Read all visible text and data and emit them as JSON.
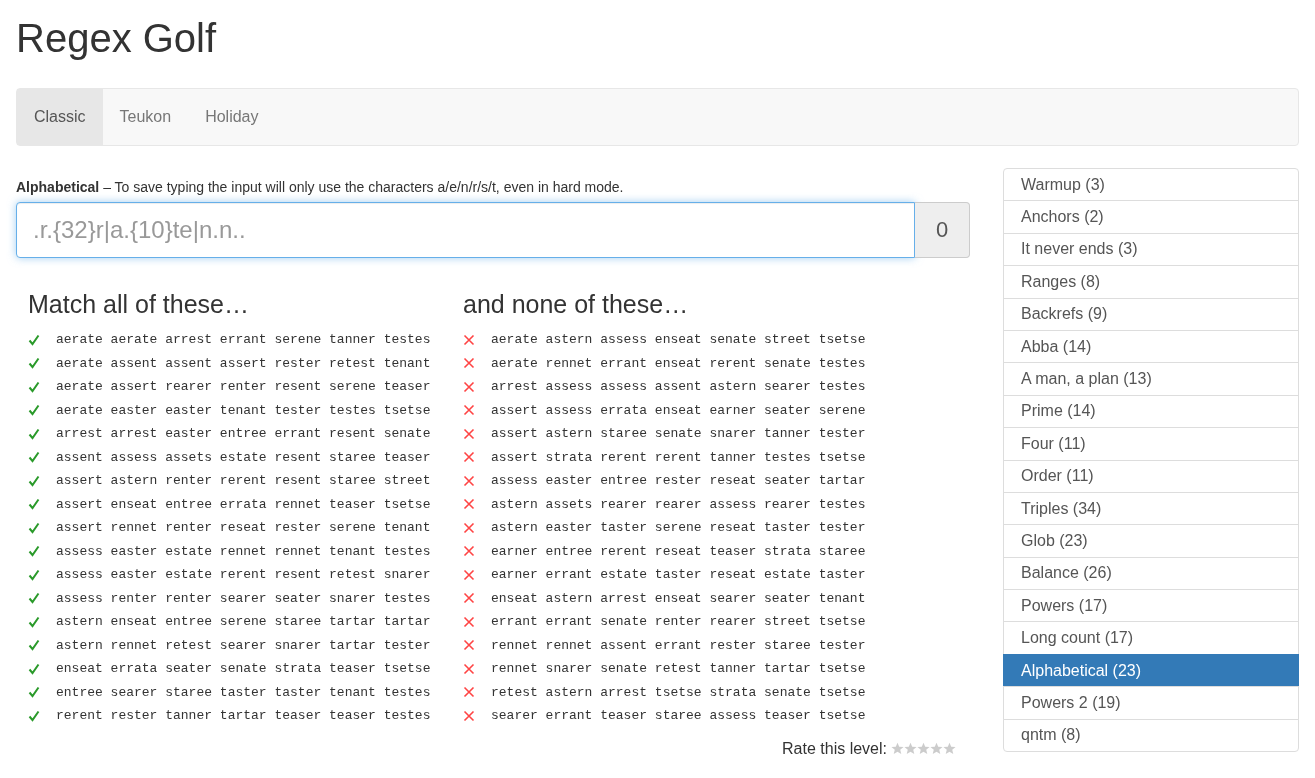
{
  "title": "Regex Golf",
  "tabs": [
    {
      "label": "Classic",
      "selected": true
    },
    {
      "label": "Teukon",
      "selected": false
    },
    {
      "label": "Holiday",
      "selected": false
    }
  ],
  "level": {
    "name": "Alphabetical",
    "description": " – To save typing the input will only use the characters a/e/n/r/s/t, even in hard mode."
  },
  "regex_input": {
    "placeholder": ".r.{32}r|a.{10}te|n.n..",
    "score": "0"
  },
  "columns": [
    {
      "kind": "match",
      "heading": "Match all of these…",
      "words": [
        "aerate aerate arrest errant serene tanner testes",
        "aerate assent assent assert rester retest tenant",
        "aerate assert rearer renter resent serene teaser",
        "aerate easter easter tenant tester testes tsetse",
        "arrest arrest easter entree errant resent senate",
        "assent assess assets estate resent staree teaser",
        "assert astern renter rerent resent staree street",
        "assert enseat entree errata rennet teaser tsetse",
        "assert rennet renter reseat rester serene tenant",
        "assess easter estate rennet rennet tenant testes",
        "assess easter estate rerent resent retest snarer",
        "assess renter renter searer seater snarer testes",
        "astern enseat entree serene staree tartar tartar",
        "astern rennet retest searer snarer tartar tester",
        "enseat errata seater senate strata teaser tsetse",
        "entree searer staree taster taster tenant testes",
        "rerent rester tanner tartar teaser teaser testes"
      ]
    },
    {
      "kind": "exclude",
      "heading": "and none of these…",
      "words": [
        "aerate astern assess enseat senate street tsetse",
        "aerate rennet errant enseat rerent senate testes",
        "arrest assess assess assent astern searer testes",
        "assert assess errata enseat earner seater serene",
        "assert astern staree senate snarer tanner tester",
        "assert strata rerent rerent tanner testes tsetse",
        "assess easter entree rester reseat seater tartar",
        "astern assets rearer rearer assess rearer testes",
        "astern easter taster serene reseat taster tester",
        "earner entree rerent reseat teaser strata staree",
        "earner errant estate taster reseat estate taster",
        "enseat astern arrest enseat searer seater tenant",
        "errant errant senate renter rearer street tsetse",
        "rennet rennet assent errant rester staree tester",
        "rennet snarer senate retest tanner tartar tsetse",
        "retest astern arrest tsetse strata senate tsetse",
        "searer errant teaser staree assess teaser tsetse"
      ]
    }
  ],
  "rating": {
    "label": "Rate this level:",
    "stars": 0
  },
  "levels": [
    {
      "label": "Warmup (3)",
      "selected": false
    },
    {
      "label": "Anchors (2)",
      "selected": false
    },
    {
      "label": "It never ends (3)",
      "selected": false
    },
    {
      "label": "Ranges (8)",
      "selected": false
    },
    {
      "label": "Backrefs (9)",
      "selected": false
    },
    {
      "label": "Abba (14)",
      "selected": false
    },
    {
      "label": "A man, a plan (13)",
      "selected": false
    },
    {
      "label": "Prime (14)",
      "selected": false
    },
    {
      "label": "Four (11)",
      "selected": false
    },
    {
      "label": "Order (11)",
      "selected": false
    },
    {
      "label": "Triples (34)",
      "selected": false
    },
    {
      "label": "Glob (23)",
      "selected": false
    },
    {
      "label": "Balance (26)",
      "selected": false
    },
    {
      "label": "Powers (17)",
      "selected": false
    },
    {
      "label": "Long count (17)",
      "selected": false
    },
    {
      "label": "Alphabetical (23)",
      "selected": true
    },
    {
      "label": "Powers 2 (19)",
      "selected": false
    },
    {
      "label": "qntm (8)",
      "selected": false
    }
  ]
}
